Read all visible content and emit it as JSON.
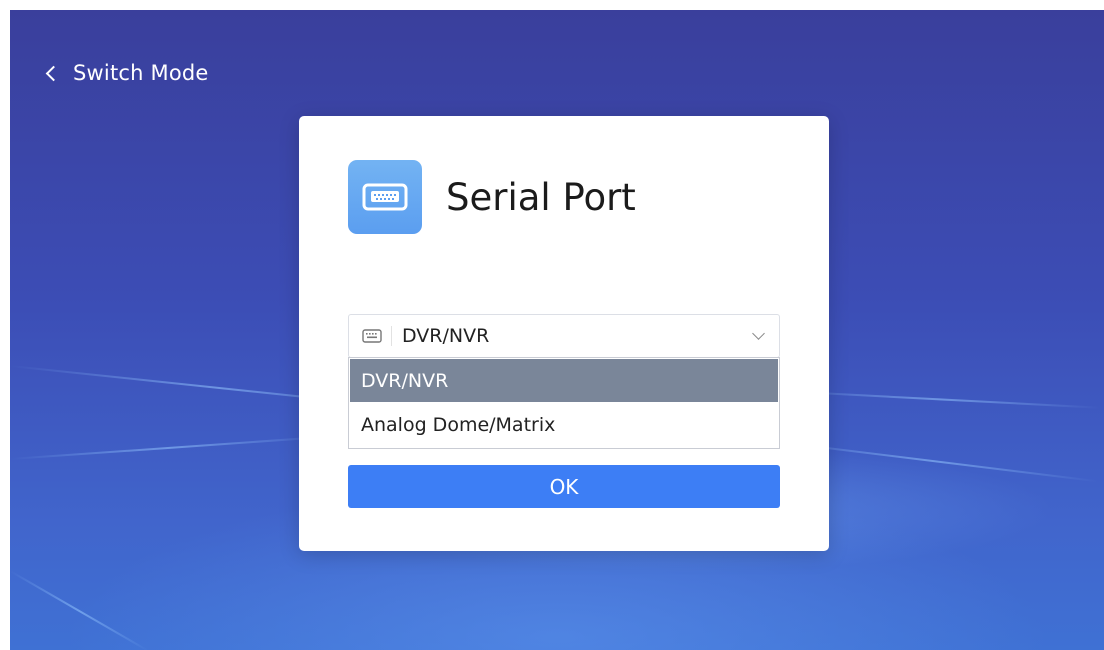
{
  "header": {
    "back_label": "Switch Mode"
  },
  "dialog": {
    "title": "Serial Port",
    "icon": "serial-port-icon",
    "select": {
      "value": "DVR/NVR",
      "icon": "keyboard-icon",
      "expanded": true
    },
    "options": [
      {
        "label": "DVR/NVR",
        "selected": true
      },
      {
        "label": "Analog Dome/Matrix",
        "selected": false
      }
    ],
    "ok_label": "OK"
  },
  "colors": {
    "background": "#3c4db5",
    "accent": "#3d7ef5",
    "icon_tile": "#5b9ef0",
    "option_highlight": "#7a8699"
  }
}
